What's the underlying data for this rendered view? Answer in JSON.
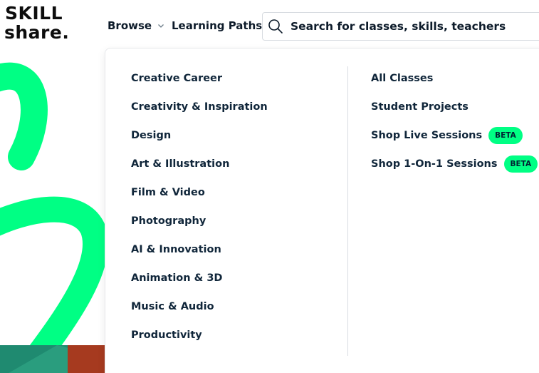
{
  "logo": {
    "line1": "SKILL",
    "line2": "share."
  },
  "nav": {
    "browse": "Browse",
    "learning_paths": "Learning Paths"
  },
  "search": {
    "placeholder": "Search for classes, skills, teachers"
  },
  "dropdown": {
    "categories": [
      "Creative Career",
      "Creativity & Inspiration",
      "Design",
      "Art & Illustration",
      "Film & Video",
      "Photography",
      "AI & Innovation",
      "Animation & 3D",
      "Music & Audio",
      "Productivity"
    ],
    "links": [
      {
        "label": "All Classes",
        "badge": ""
      },
      {
        "label": "Student Projects",
        "badge": ""
      },
      {
        "label": "Shop Live Sessions",
        "badge": "BETA"
      },
      {
        "label": "Shop 1-On-1 Sessions",
        "badge": "BETA"
      }
    ]
  },
  "colors": {
    "brand_green": "#00ff84",
    "text_navy": "#002333",
    "hero_teal": "#1f8a70",
    "hero_rust": "#a63a1f"
  }
}
